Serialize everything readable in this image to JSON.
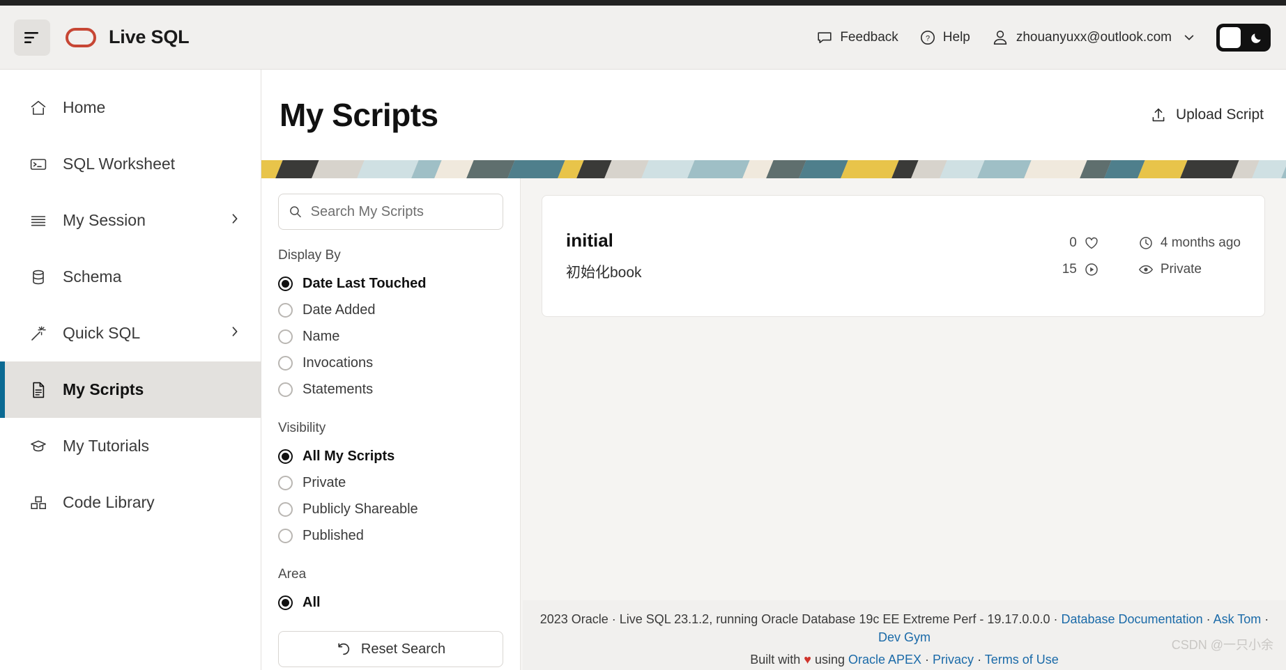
{
  "header": {
    "menu_icon": "hamburger-icon",
    "logo_icon": "oracle-oval-icon",
    "brand_title": "Live SQL",
    "feedback_label": "Feedback",
    "help_label": "Help",
    "user_email": "zhouanyuxx@outlook.com",
    "theme_toggle_icon": "moon-icon",
    "accent_color": "#C74634"
  },
  "sidebar": {
    "items": [
      {
        "label": "Home",
        "icon": "home-icon",
        "active": false,
        "chevron": false
      },
      {
        "label": "SQL Worksheet",
        "icon": "terminal-icon",
        "active": false,
        "chevron": false
      },
      {
        "label": "My Session",
        "icon": "list-icon",
        "active": false,
        "chevron": true
      },
      {
        "label": "Schema",
        "icon": "database-icon",
        "active": false,
        "chevron": false
      },
      {
        "label": "Quick SQL",
        "icon": "magic-wand-icon",
        "active": false,
        "chevron": true
      },
      {
        "label": "My Scripts",
        "icon": "document-icon",
        "active": true,
        "chevron": false
      },
      {
        "label": "My Tutorials",
        "icon": "graduation-cap-icon",
        "active": false,
        "chevron": false
      },
      {
        "label": "Code Library",
        "icon": "blocks-icon",
        "active": false,
        "chevron": false
      }
    ],
    "active_accent_color": "#0b6a93"
  },
  "main": {
    "page_title": "My Scripts",
    "upload_label": "Upload Script",
    "upload_icon": "upload-icon"
  },
  "search": {
    "placeholder": "Search My Scripts",
    "value": "",
    "icon": "search-icon"
  },
  "filters": {
    "display_by": {
      "title": "Display By",
      "options": [
        {
          "label": "Date Last Touched",
          "checked": true
        },
        {
          "label": "Date Added",
          "checked": false
        },
        {
          "label": "Name",
          "checked": false
        },
        {
          "label": "Invocations",
          "checked": false
        },
        {
          "label": "Statements",
          "checked": false
        }
      ]
    },
    "visibility": {
      "title": "Visibility",
      "options": [
        {
          "label": "All My Scripts",
          "checked": true
        },
        {
          "label": "Private",
          "checked": false
        },
        {
          "label": "Publicly Shareable",
          "checked": false
        },
        {
          "label": "Published",
          "checked": false
        }
      ]
    },
    "area": {
      "title": "Area",
      "options": [
        {
          "label": "All",
          "checked": true
        }
      ]
    },
    "reset_label": "Reset Search",
    "reset_icon": "undo-icon"
  },
  "results": {
    "cards": [
      {
        "title": "initial",
        "description": "初始化book",
        "likes": "0",
        "likes_icon": "heart-icon",
        "runs": "15",
        "runs_icon": "play-circle-icon",
        "updated": "4 months ago",
        "updated_icon": "clock-icon",
        "visibility": "Private",
        "visibility_icon": "eye-icon"
      }
    ]
  },
  "footer": {
    "line1_prefix": "2023 Oracle · Live SQL 23.1.2, running Oracle Database 19c EE Extreme Perf - 19.17.0.0.0 · ",
    "link_db_doc": "Database Documentation",
    "sep1": " · ",
    "link_ask_tom": "Ask Tom",
    "sep2": " · ",
    "link_dev_gym": "Dev Gym",
    "built_with": "Built with ",
    "heart": "♥",
    "using": " using ",
    "link_apex": "Oracle APEX",
    "sep3": " · ",
    "link_privacy": "Privacy",
    "sep4": " · ",
    "link_terms": "Terms of Use",
    "link_color": "#1a6aa8"
  },
  "watermark": "CSDN @一只小余"
}
